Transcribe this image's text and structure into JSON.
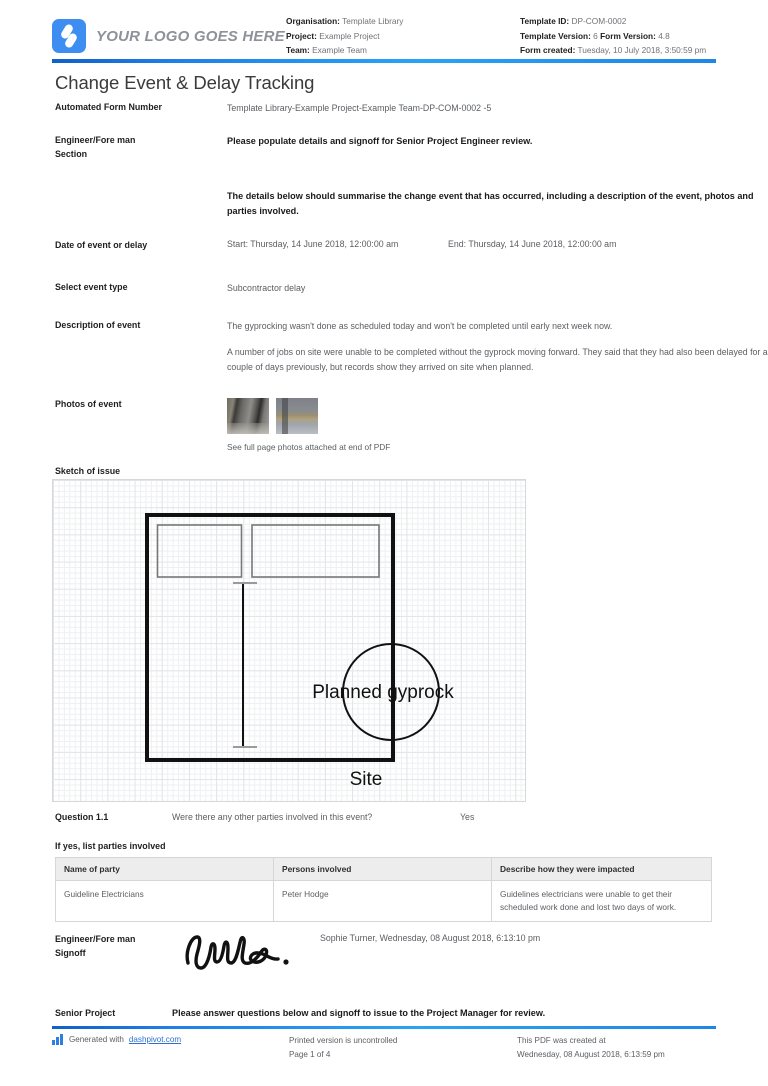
{
  "header": {
    "logo_text": "YOUR LOGO GOES HERE",
    "meta_left": [
      {
        "label": "Organisation:",
        "value": " Template Library"
      },
      {
        "label": "Project:",
        "value": " Example Project"
      },
      {
        "label": "Team:",
        "value": " Example Team"
      }
    ],
    "meta_right": [
      {
        "label": "Template ID:",
        "value": " DP-COM-0002"
      },
      {
        "label": "Template Version:",
        "value": " 6 ",
        "label2": "Form Version:",
        "value2": " 4.8"
      },
      {
        "label": "Form created:",
        "value": " Tuesday, 10 July 2018, 3:50:59 pm"
      }
    ]
  },
  "title": "Change Event & Delay Tracking",
  "fields": {
    "form_number_label": "Automated Form Number",
    "form_number_value": "Template Library-Example Project-Example Team-DP-COM-0002   -5",
    "engineer_section_label": "Engineer/Fore man Section",
    "engineer_section_value": "Please populate details and signoff for Senior Project Engineer review.",
    "summary_value": "The details below should summarise the change event that has occurred, including a description of the event, photos and parties involved.",
    "date_label": "Date of event or delay",
    "date_start": "Start: Thursday, 14 June 2018, 12:00:00 am",
    "date_end": "End: Thursday, 14 June 2018, 12:00:00 am",
    "event_type_label": "Select event type",
    "event_type_value": "Subcontractor delay",
    "description_label": "Description of event",
    "description_p1": "The gyprocking wasn't done as scheduled today and won't be completed until early next week now.",
    "description_p2": "A number of jobs on site were unable to be completed without the gyprock moving forward. They said that they had also been delayed for a couple of days previously, but records show they arrived on site when planned.",
    "photos_label": "Photos of event",
    "photos_caption": "See full page photos attached at end of PDF"
  },
  "sketch": {
    "heading": "Sketch of issue",
    "label_gyprock": "Planned gyprock",
    "label_site": "Site"
  },
  "question": {
    "number": "Question 1.1",
    "text": "Were there any other parties involved in this event?",
    "answer": "Yes"
  },
  "parties": {
    "heading": "If yes, list parties involved",
    "columns": [
      "Name of party",
      "Persons involved",
      "Describe how they were impacted"
    ],
    "rows": [
      {
        "name": "Guideline Electricians",
        "person": "Peter Hodge",
        "impact": "Guidelines electricians were unable to get their scheduled work done and lost two days of work."
      }
    ]
  },
  "signoff": {
    "label": "Engineer/Fore man Signoff",
    "name_date": "Sophie Turner, Wednesday, 08 August 2018, 6:13:10 pm",
    "signature_alt": "Sophie"
  },
  "senior": {
    "label": "Senior Project",
    "text": "Please answer questions below and signoff to issue to the Project Manager for review."
  },
  "footer": {
    "generated_prefix": "Generated with ",
    "generated_link": "dashpivot.com",
    "uncontrolled": "Printed version is uncontrolled",
    "page": "Page 1 of 4",
    "created_label": "This PDF was created at",
    "created_date": "Wednesday, 08 August 2018, 6:13:59 pm"
  },
  "colors": {
    "brand_blue": "#29a3f5",
    "rule_blue": "#1f7fe8",
    "link_blue": "#2f6fd0",
    "table_header_bg": "#ededed"
  }
}
